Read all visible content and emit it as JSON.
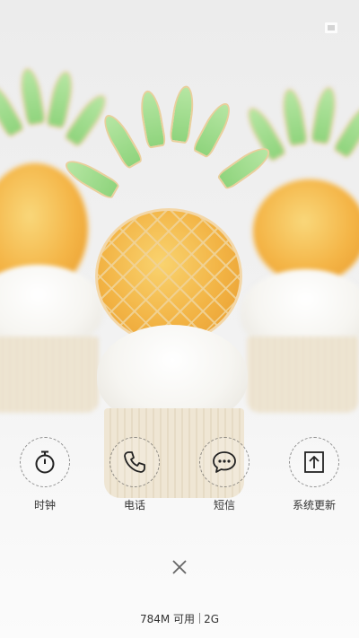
{
  "shortcuts": [
    {
      "label": "时钟",
      "icon": "clock-icon"
    },
    {
      "label": "电话",
      "icon": "phone-icon"
    },
    {
      "label": "短信",
      "icon": "message-icon"
    },
    {
      "label": "系统更新",
      "icon": "system-update-icon"
    }
  ],
  "memory": {
    "available": "784M 可用",
    "network": "2G"
  },
  "colors": {
    "text": "#333333",
    "ring": "#3c3c3c"
  }
}
